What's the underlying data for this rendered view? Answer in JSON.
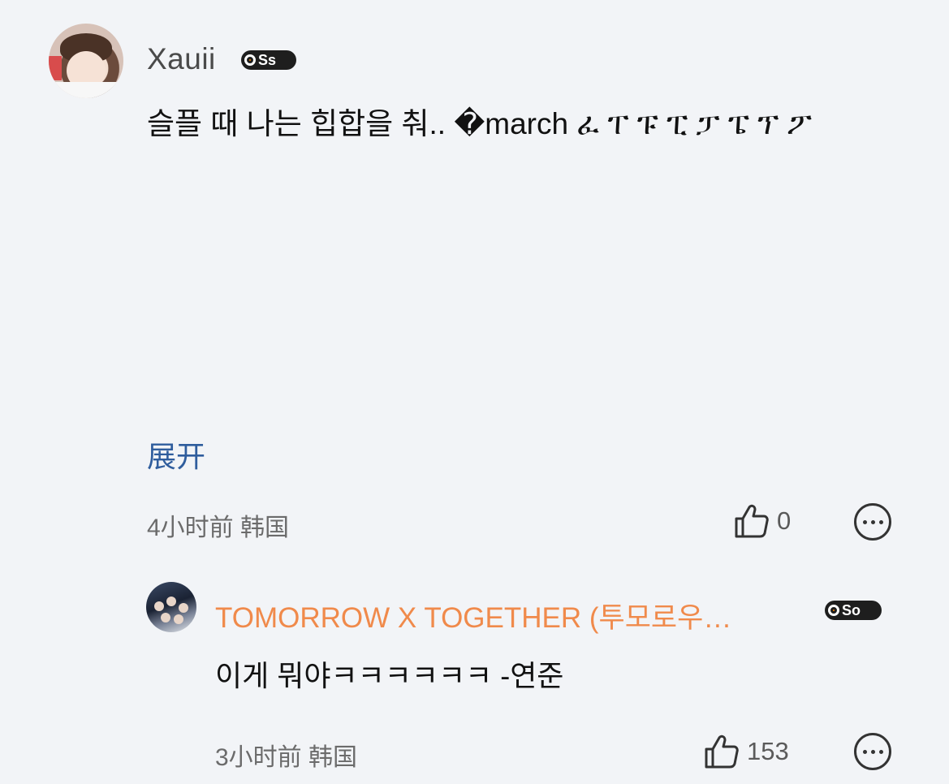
{
  "main_comment": {
    "username": "Xauii",
    "badge": "Ss",
    "text": "슬플 때 나는 힙합을 춰.. �march ፈ ፐ ፑ ፒ ፓ ፔ ፕ ፖ",
    "expand_label": "展开",
    "time": "4小时前",
    "location": "韩国",
    "like_count": "0"
  },
  "reply": {
    "username": "TOMORROW X TOGETHER (투모로우…",
    "badge": "So",
    "text": "이게 뭐야ㅋㅋㅋㅋㅋㅋ -연준",
    "time": "3小时前",
    "location": "韩国",
    "like_count": "153"
  },
  "icons": {
    "like": "thumbs-up-icon",
    "comment": "comment-bubble-icon"
  },
  "colors": {
    "background": "#f2f4f7",
    "reply_username": "#f08a4b",
    "expand_link": "#2f5d9d"
  }
}
